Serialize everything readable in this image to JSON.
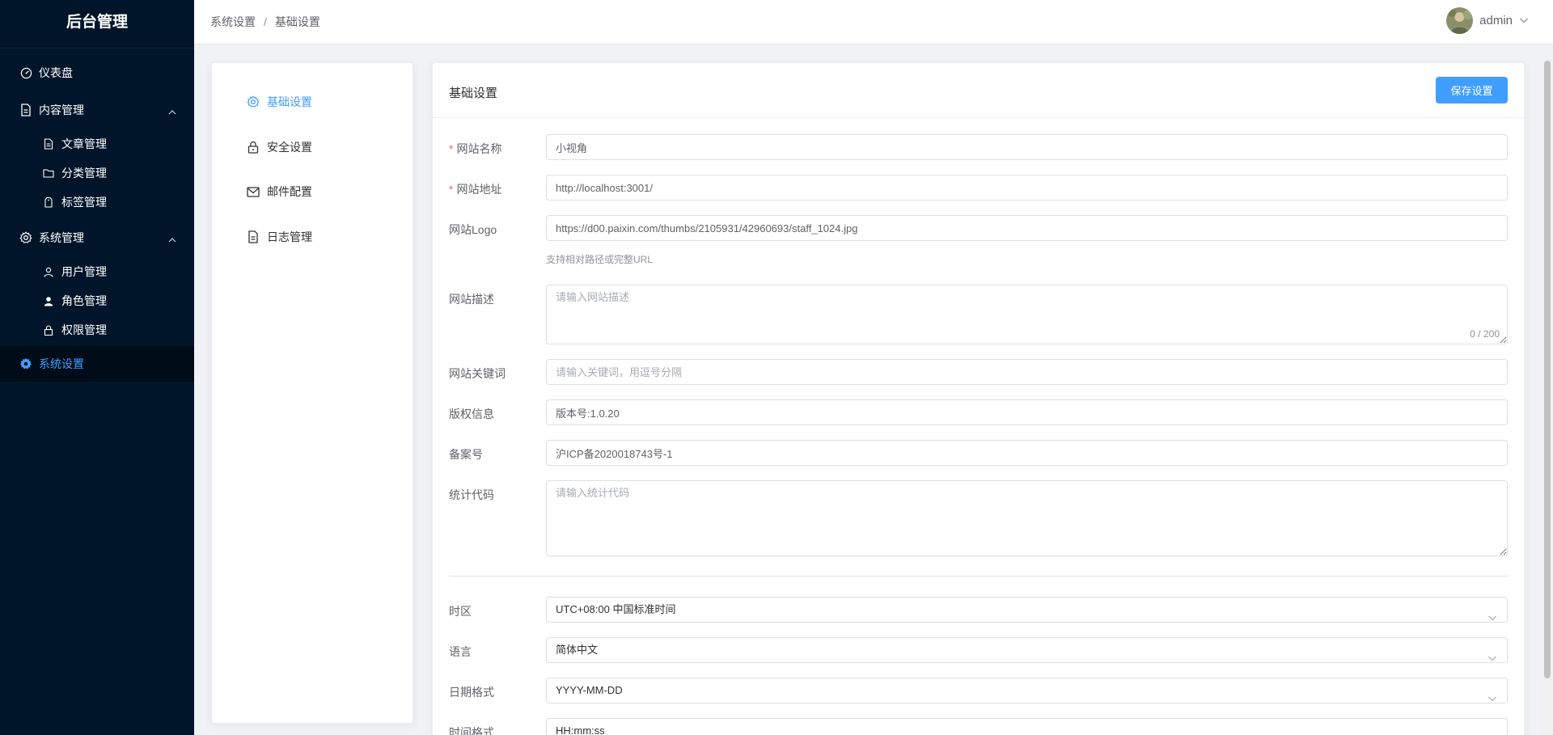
{
  "sidebar": {
    "brand": "后台管理",
    "dashboard": "仪表盘",
    "content_group": "内容管理",
    "content_items": [
      "文章管理",
      "分类管理",
      "标签管理"
    ],
    "system_group": "系统管理",
    "system_items": [
      "用户管理",
      "角色管理",
      "权限管理"
    ],
    "settings": "系统设置"
  },
  "header": {
    "breadcrumb": [
      "系统设置",
      "基础设置"
    ],
    "breadcrumb_separator": "/",
    "username": "admin"
  },
  "settings_nav": {
    "items": [
      "基础设置",
      "安全设置",
      "邮件配置",
      "日志管理"
    ]
  },
  "form": {
    "title": "基础设置",
    "save_label": "保存设置",
    "site_name_label": "网站名称",
    "site_name_value": "小视角",
    "site_url_label": "网站地址",
    "site_url_value": "http://localhost:3001/",
    "logo_label": "网站Logo",
    "logo_value": "https://d00.paixin.com/thumbs/2105931/42960693/staff_1024.jpg",
    "logo_hint": "支持相对路径或完整URL",
    "desc_label": "网站描述",
    "desc_placeholder": "请输入网站描述",
    "desc_counter": "0 / 200",
    "keywords_label": "网站关键词",
    "keywords_placeholder": "请输入关键词，用逗号分隔",
    "copyright_label": "版权信息",
    "copyright_value": "版本号:1.0.20",
    "icp_label": "备案号",
    "icp_value": "沪ICP备2020018743号-1",
    "stats_label": "统计代码",
    "stats_placeholder": "请输入统计代码",
    "timezone_label": "时区",
    "timezone_value": "UTC+08:00 中国标准时间",
    "language_label": "语言",
    "language_value": "简体中文",
    "date_format_label": "日期格式",
    "date_format_value": "YYYY-MM-DD",
    "time_format_label": "时间格式",
    "time_format_value": "HH:mm:ss"
  },
  "colors": {
    "sidebar_bg": "#001529",
    "accent": "#409eff",
    "required": "#f56c6c"
  }
}
